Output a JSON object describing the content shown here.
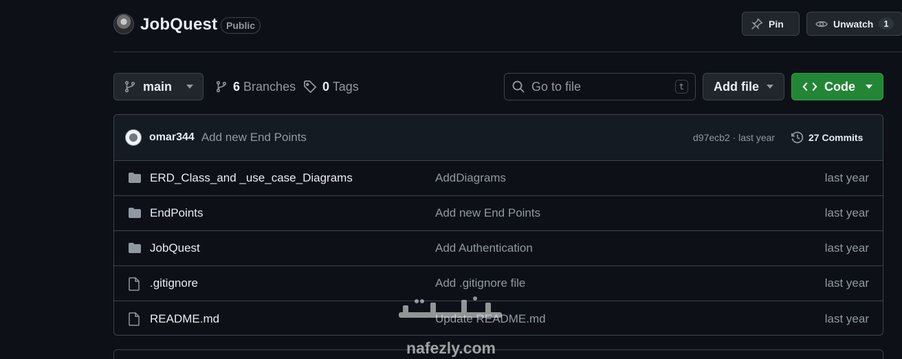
{
  "repo": {
    "name": "JobQuest",
    "visibility": "Public",
    "pin_label": "Pin",
    "watch_label": "Unwatch",
    "watch_count": "1"
  },
  "toolbar": {
    "branch": "main",
    "branches_count": "6",
    "branches_label": "Branches",
    "tags_count": "0",
    "tags_label": "Tags",
    "search_placeholder": "Go to file",
    "search_shortcut": "t",
    "add_file_label": "Add file",
    "code_label": "Code"
  },
  "latest_commit": {
    "author": "omar344",
    "message": "Add new End Points",
    "hash_and_time": "d97ecb2 · last year",
    "commits_label": "27 Commits"
  },
  "files": [
    {
      "type": "folder",
      "name": "ERD_Class_and _use_case_Diagrams",
      "message": "AddDiagrams",
      "date": "last year"
    },
    {
      "type": "folder",
      "name": "EndPoints",
      "message": "Add new End Points",
      "date": "last year"
    },
    {
      "type": "folder",
      "name": "JobQuest",
      "message": "Add Authentication",
      "date": "last year"
    },
    {
      "type": "file",
      "name": ".gitignore",
      "message": "Add .gitignore file",
      "date": "last year"
    },
    {
      "type": "file",
      "name": "README.md",
      "message": "Update README.md",
      "date": "last year"
    }
  ],
  "watermark": {
    "text": "nafezly.com"
  },
  "colors": {
    "background": "#0d1117",
    "code_button": "#238636",
    "border": "#3d444d",
    "muted_text": "#9198a1"
  }
}
